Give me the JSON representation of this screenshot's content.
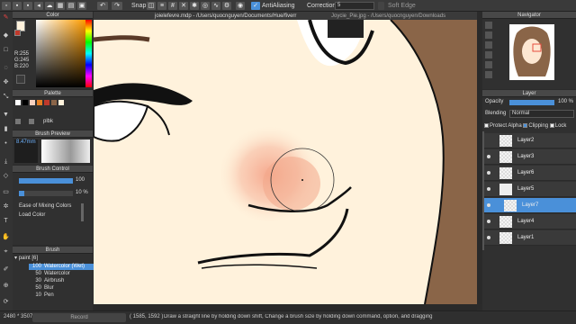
{
  "toolbar": {
    "snap_label": "Snap",
    "antialiasing_label": "AntiAliasing",
    "correction_label": "Correction",
    "correction_value": "5",
    "soft_edge_label": "Soft Edge"
  },
  "tabs": [
    {
      "label": "joielefevre.mdp - /Users/quocnguyen/Documents/Hue/fiverr"
    },
    {
      "label": "Joycie_Pie.jpg - /Users/quocnguyen/Downloads"
    }
  ],
  "color_panel": {
    "title": "Color",
    "r": "R:255",
    "g": "G:245",
    "b": "B:220"
  },
  "palette_panel": {
    "title": "Palette",
    "file_label": "plbk"
  },
  "brush_preview": {
    "title": "Brush Preview",
    "size": "8.47mm"
  },
  "brush_control": {
    "title": "Brush Control",
    "size_value": "100",
    "opacity_value": "10 %",
    "ease_label": "Ease of Mixing Colors",
    "load_label": "Load Color"
  },
  "brush_panel": {
    "title": "Brush",
    "group": "paint [6]",
    "items": [
      {
        "size": "100",
        "name": "Watercolor (Wet)"
      },
      {
        "size": "50",
        "name": "Watercolor"
      },
      {
        "size": "30",
        "name": "Airbrush"
      },
      {
        "size": "50",
        "name": "Blur"
      },
      {
        "size": "10",
        "name": "Pen"
      }
    ]
  },
  "navigator": {
    "title": "Navigator"
  },
  "layer_panel": {
    "title": "Layer",
    "opacity_label": "Opacity",
    "opacity_value": "100 %",
    "blending_label": "Blending",
    "blending_value": "Normal",
    "protect_alpha": "Protect Alpha",
    "clipping": "Clipping",
    "lock": "Lock",
    "layers": [
      {
        "name": "Layer2"
      },
      {
        "name": "Layer3"
      },
      {
        "name": "Layer6"
      },
      {
        "name": "Layer5"
      },
      {
        "name": "Layer7"
      },
      {
        "name": "Layer4"
      },
      {
        "name": "Layer1"
      }
    ]
  },
  "status": {
    "dimensions": "2480 * 3507",
    "record_label": "Record",
    "coords": "( 1585, 1592 )",
    "hint": "Draw a straight line by holding down shift, Change a brush size by holding down command, option, and dragging"
  },
  "colors": {
    "accent": "#4a90d9",
    "canvas_bg": "#fff2dc",
    "hair": "#8a6548",
    "blush": "#f2a88a"
  }
}
